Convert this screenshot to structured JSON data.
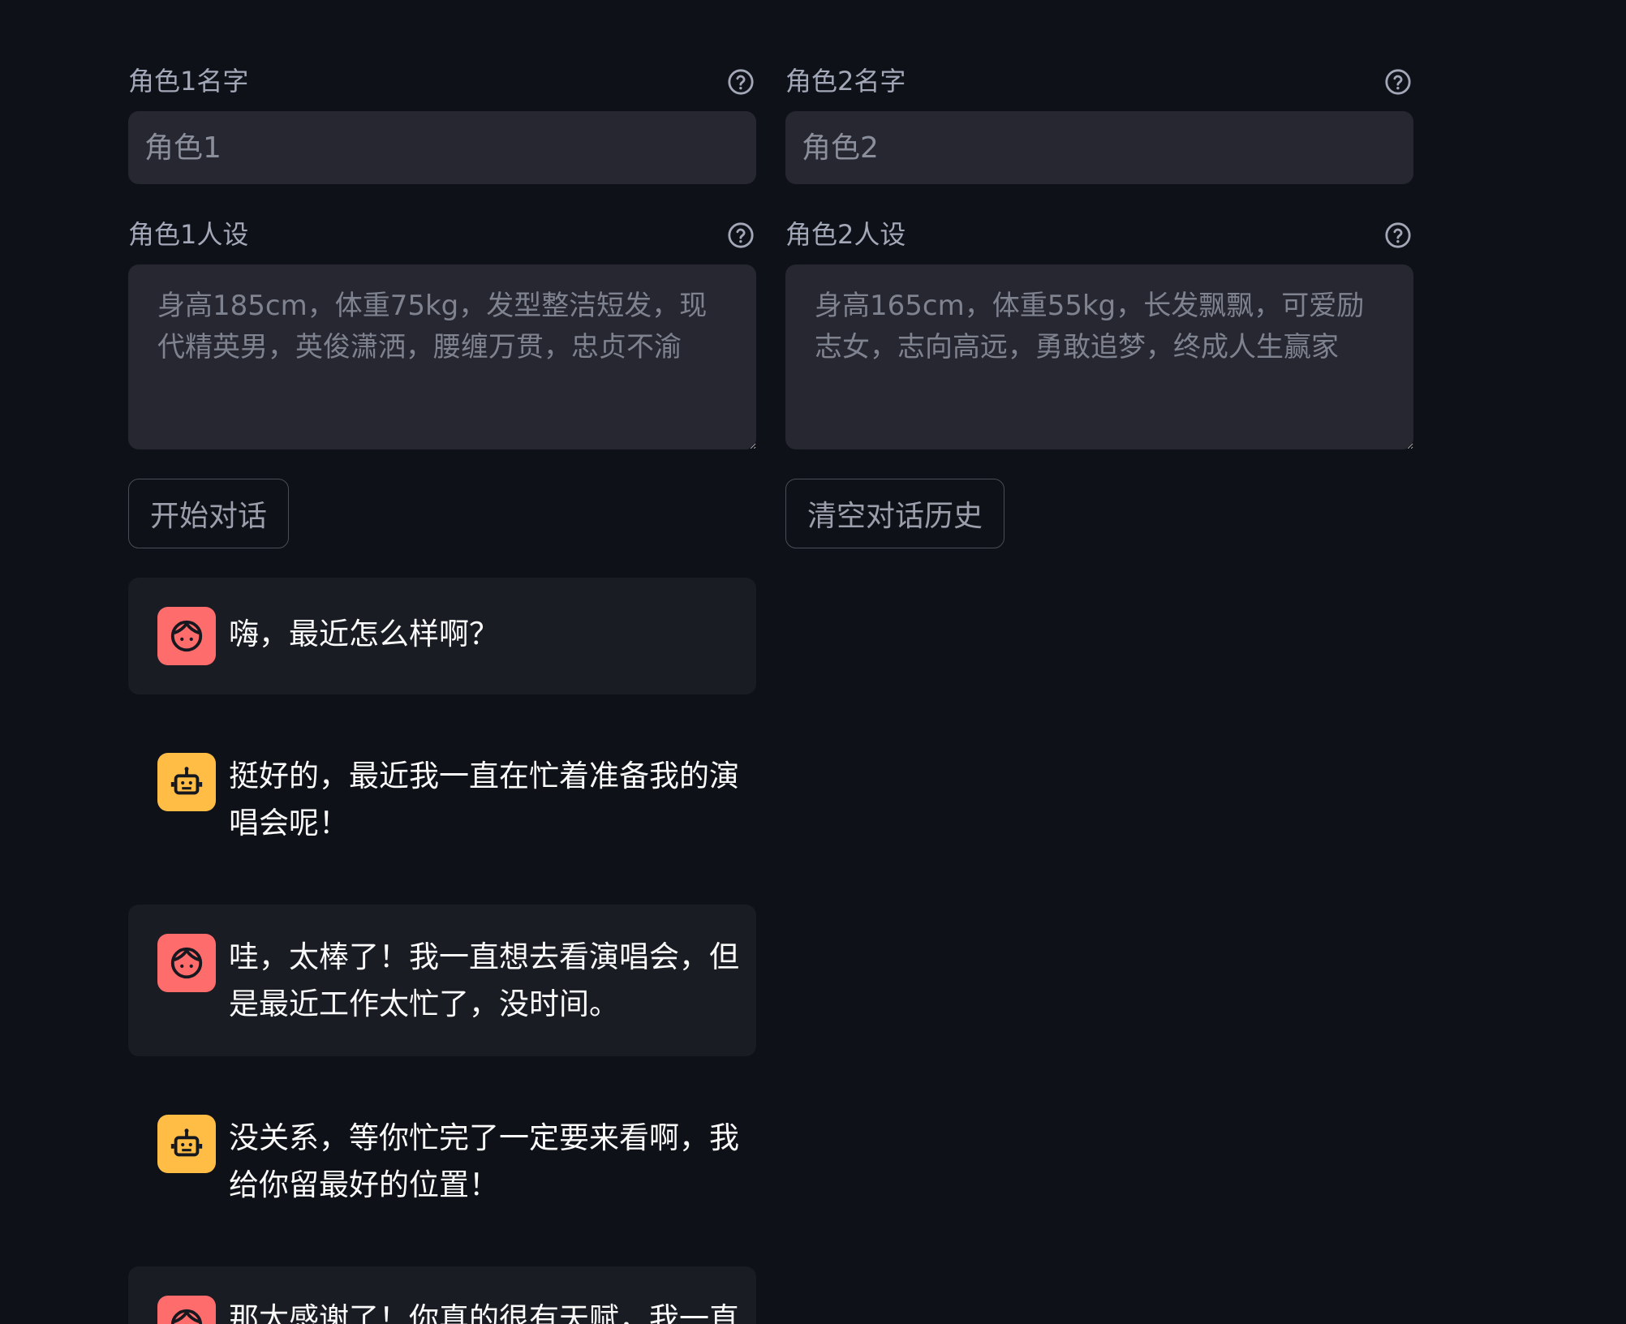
{
  "left": {
    "name_label": "角色1名字",
    "name_placeholder": "角色1",
    "persona_label": "角色1人设",
    "persona_placeholder": "身高185cm，体重75kg，发型整洁短发，现代精英男，英俊潇洒，腰缠万贯，忠贞不渝",
    "start_button": "开始对话"
  },
  "right": {
    "name_label": "角色2名字",
    "name_placeholder": "角色2",
    "persona_label": "角色2人设",
    "persona_placeholder": "身高165cm，体重55kg，长发飘飘，可爱励志女，志向高远，勇敢追梦，终成人生赢家",
    "clear_button": "清空对话历史"
  },
  "icons": {
    "help": "question-circle-icon",
    "user_avatar": "user-face-icon",
    "assistant_avatar": "robot-icon"
  },
  "colors": {
    "background": "#0e1117",
    "input_bg": "#262730",
    "user_avatar": "#ff6c6c",
    "assistant_avatar": "#ffbd45",
    "user_message_bg": "#1a1c24"
  },
  "messages": [
    {
      "role": "user",
      "text": "嗨，最近怎么样啊？"
    },
    {
      "role": "assistant",
      "text": "挺好的，最近我一直在忙着准备我的演唱会呢！"
    },
    {
      "role": "user",
      "text": "哇，太棒了！我一直想去看演唱会，但是最近工作太忙了，没时间。"
    },
    {
      "role": "assistant",
      "text": "没关系，等你忙完了一定要来看啊，我给你留最好的位置！"
    },
    {
      "role": "user",
      "text": "那太感谢了！你真的很有天赋，我一直"
    }
  ]
}
